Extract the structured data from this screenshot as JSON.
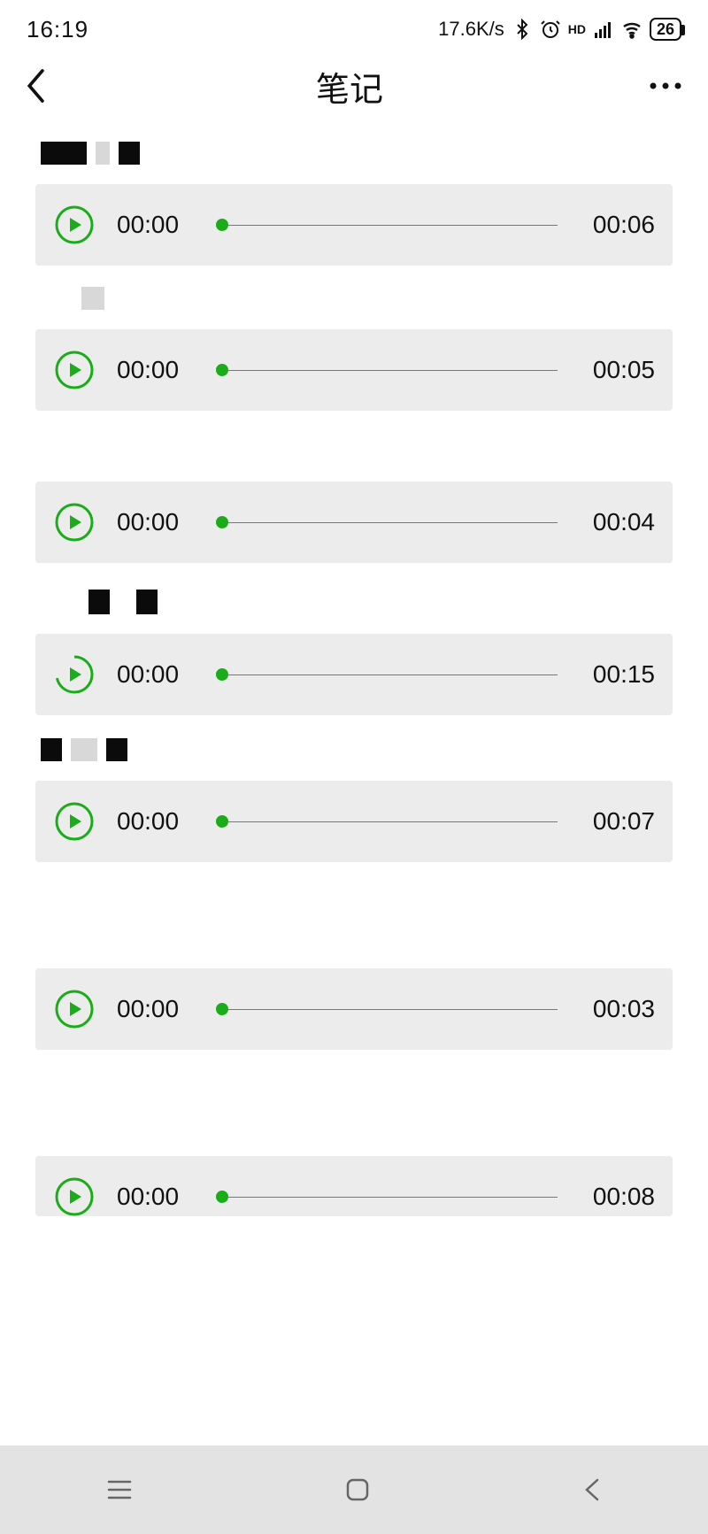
{
  "status": {
    "time": "16:19",
    "speed": "17.6K/s",
    "battery": "26"
  },
  "nav": {
    "title": "笔记"
  },
  "clips": [
    {
      "start": "00:00",
      "end": "00:06"
    },
    {
      "start": "00:00",
      "end": "00:05"
    },
    {
      "start": "00:00",
      "end": "00:04"
    },
    {
      "start": "00:00",
      "end": "00:15"
    },
    {
      "start": "00:00",
      "end": "00:07"
    },
    {
      "start": "00:00",
      "end": "00:03"
    },
    {
      "start": "00:00",
      "end": "00:08"
    }
  ]
}
